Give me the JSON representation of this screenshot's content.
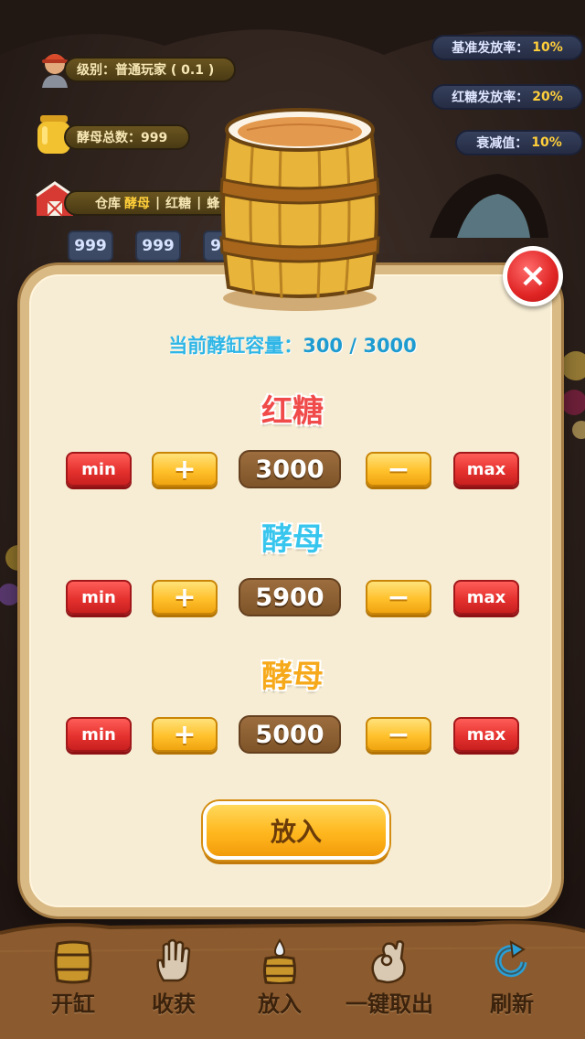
{
  "hud": {
    "level_label": "级别：普通玩家 ( 0.1 )",
    "yeast_total_label": "酵母总数：999",
    "warehouse_label": "仓库",
    "warehouse_items": [
      "酵母",
      "红糖",
      "蜂"
    ],
    "warehouse_sep": "|",
    "warehouse_counts": [
      "999",
      "999",
      "99"
    ],
    "base_rate_label": "基准发放率：",
    "base_rate_value": "10%",
    "sugar_rate_label": "红糖发放率：",
    "sugar_rate_value": "20%",
    "decay_label": "衰减值：",
    "decay_value": "10%"
  },
  "panel": {
    "capacity_label": "当前酵缸容量：",
    "capacity_value": "300 / 3000",
    "sections": [
      {
        "title": "红糖",
        "title_color": "#f04a4a",
        "value": "3000"
      },
      {
        "title": "酵母",
        "title_color": "#38c6ee",
        "value": "5900"
      },
      {
        "title": "酵母",
        "title_color": "#f6a91a",
        "value": "5000"
      }
    ],
    "min_label": "min",
    "max_label": "max",
    "plus_label": "+",
    "minus_label": "−",
    "put_button": "放入",
    "close_icon": "×"
  },
  "bottom_nav": [
    {
      "label": "开缸",
      "icon": "barrel-icon"
    },
    {
      "label": "收获",
      "icon": "hand-icon"
    },
    {
      "label": "放入",
      "icon": "drop-barrel-icon"
    },
    {
      "label": "一键取出",
      "icon": "ok-hand-icon"
    },
    {
      "label": "刷新",
      "icon": "refresh-icon"
    }
  ],
  "colors": {
    "panel_bg": "#f7edd4",
    "button_red": "#e5322f",
    "button_yellow": "#ffc12c",
    "value_box": "#8a5e30"
  }
}
